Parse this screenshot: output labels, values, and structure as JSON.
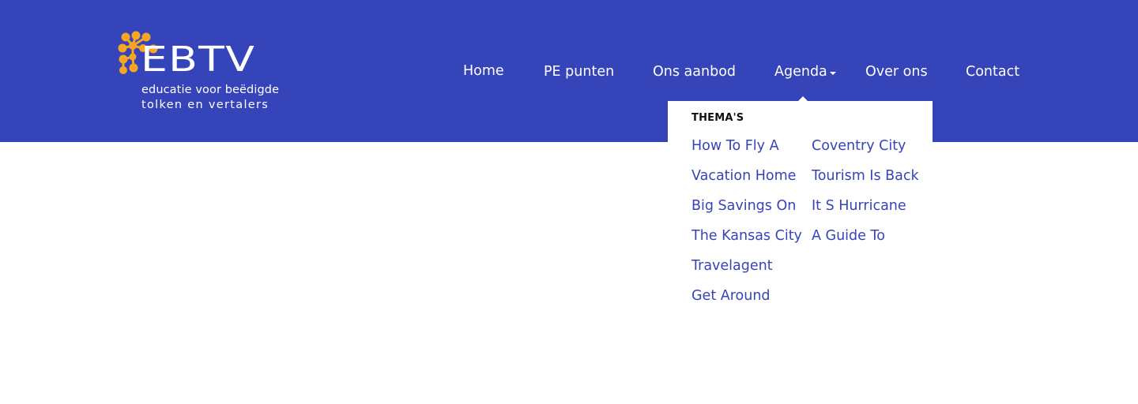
{
  "logo": {
    "word": "EBTV",
    "tagline_line1": "educatie voor beëdigde",
    "tagline_line2": "tolken en vertalers",
    "brand_color": "#3544b9",
    "accent_color": "#f6a623"
  },
  "nav": {
    "items": [
      {
        "label": "Home"
      },
      {
        "label": "PE punten"
      },
      {
        "label": "Ons aanbod"
      },
      {
        "label": "Agenda"
      },
      {
        "label": "Over ons"
      },
      {
        "label": "Contact"
      }
    ],
    "dropdown_icon": "caret-down-icon"
  },
  "dropdown": {
    "heading": "THEMA'S",
    "column1": [
      {
        "label": "How To Fly A"
      },
      {
        "label": "Vacation Home"
      },
      {
        "label": "Big Savings On"
      },
      {
        "label": "The Kansas City"
      },
      {
        "label": "Travelagent"
      },
      {
        "label": "Get Around"
      }
    ],
    "column2": [
      {
        "label": "Coventry City"
      },
      {
        "label": "Tourism Is Back"
      },
      {
        "label": "It S Hurricane"
      },
      {
        "label": "A Guide To"
      }
    ]
  }
}
